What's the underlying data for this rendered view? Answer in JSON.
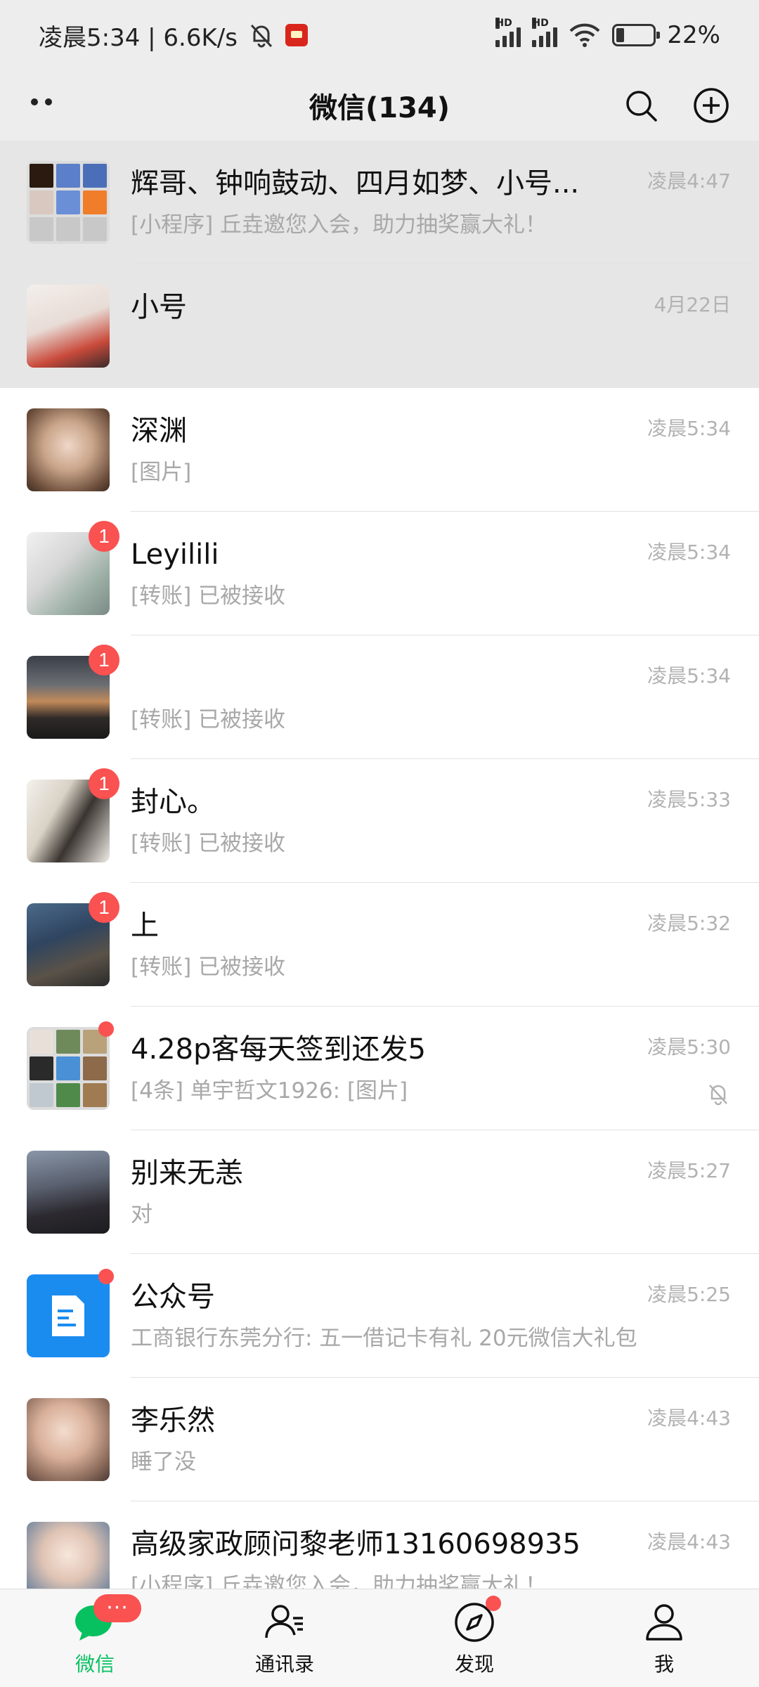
{
  "status_bar": {
    "time_speed": "凌晨5:34 | 6.6K/s",
    "battery": "22%",
    "battery_level": 0.22
  },
  "header": {
    "title": "微信(134)"
  },
  "chats": [
    {
      "name": "辉哥、钟响鼓动、四月如梦、小号...",
      "preview": "[小程序] 丘垚邀您入会，助力抽奖赢大礼！",
      "time": "凌晨4:47",
      "pinned": true
    },
    {
      "name": "小号",
      "preview": "",
      "time": "4月22日",
      "pinned": true
    },
    {
      "name": "深渊",
      "preview": "[图片]",
      "time": "凌晨5:34"
    },
    {
      "name": "Leyilili",
      "preview": "[转账] 已被接收",
      "time": "凌晨5:34",
      "badge": "1"
    },
    {
      "name": "",
      "preview": "[转账] 已被接收",
      "time": "凌晨5:34",
      "badge": "1"
    },
    {
      "name": "封心。",
      "preview": "[转账] 已被接收",
      "time": "凌晨5:33",
      "badge": "1"
    },
    {
      "name": "上",
      "preview": "[转账] 已被接收",
      "time": "凌晨5:32",
      "badge": "1"
    },
    {
      "name": "4.28p客每天签到还发5",
      "preview": "[4条] 单宇哲文1926: [图片]",
      "time": "凌晨5:30",
      "muted": true
    },
    {
      "name": "别来无恙",
      "preview": "对",
      "time": "凌晨5:27"
    },
    {
      "name": "公众号",
      "preview": "工商银行东莞分行: 五一借记卡有礼 20元微信大礼包",
      "time": "凌晨5:25"
    },
    {
      "name": "李乐然",
      "preview": "睡了没",
      "time": "凌晨4:43"
    },
    {
      "name": "高级家政顾问黎老师13160698935",
      "preview": "[小程序] 丘垚邀您入会，助力抽奖赢大礼！",
      "time": "凌晨4:43"
    }
  ],
  "tabs": {
    "chats": "微信",
    "contacts": "通讯录",
    "discover": "发现",
    "me": "我",
    "chats_badge": "···"
  },
  "colors": {
    "accent": "#07c160",
    "badge": "#fa5151",
    "pinned_bg": "#e6e6e6"
  }
}
